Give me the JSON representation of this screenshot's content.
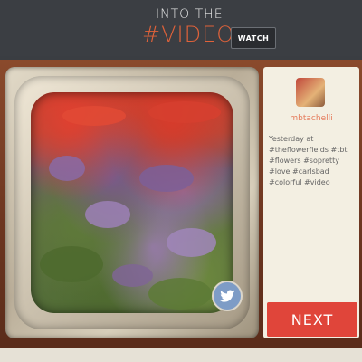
{
  "header": {
    "title_line1": "INTO THE",
    "title_line2": "#VIDEO",
    "watch_label": "WATCH"
  },
  "post": {
    "username": "mbtachelli",
    "caption": "Yesterday at #theflowerfields #tbt #flowers #sopretty #love #carlsbad #colorful #video"
  },
  "actions": {
    "next_label": "NEXT"
  },
  "colors": {
    "accent": "#e0453a",
    "title_accent": "#e0623a",
    "twitter": "#7e9cc6"
  }
}
